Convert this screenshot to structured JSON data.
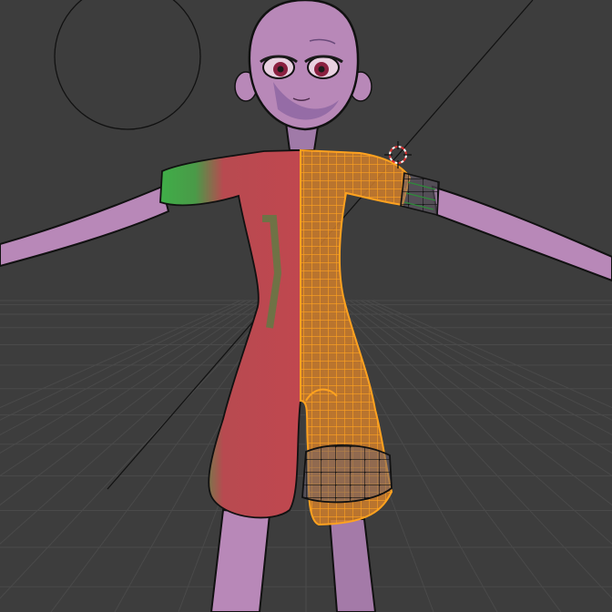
{
  "viewport": {
    "background": "#3d3d3d",
    "grid_color": "#4a4a4a",
    "overlay_line_color": "#111111"
  },
  "character": {
    "skin_color": "#b888b8",
    "skin_shadow": "#7d5a9a",
    "outline_color": "#111111",
    "iris_color": "#8a2040",
    "lash_color": "#1a1a1a"
  },
  "mesh": {
    "weight_red": "#c0474f",
    "weight_green": "#3fae48",
    "selected_wire": "#ff9a1a",
    "selected_fill": "#e08a2a",
    "active_vertices": "#111111"
  },
  "cursor_3d": {
    "icon": "3d-cursor-icon",
    "ring_color": "#ffffff",
    "accent_color": "#e03030"
  }
}
